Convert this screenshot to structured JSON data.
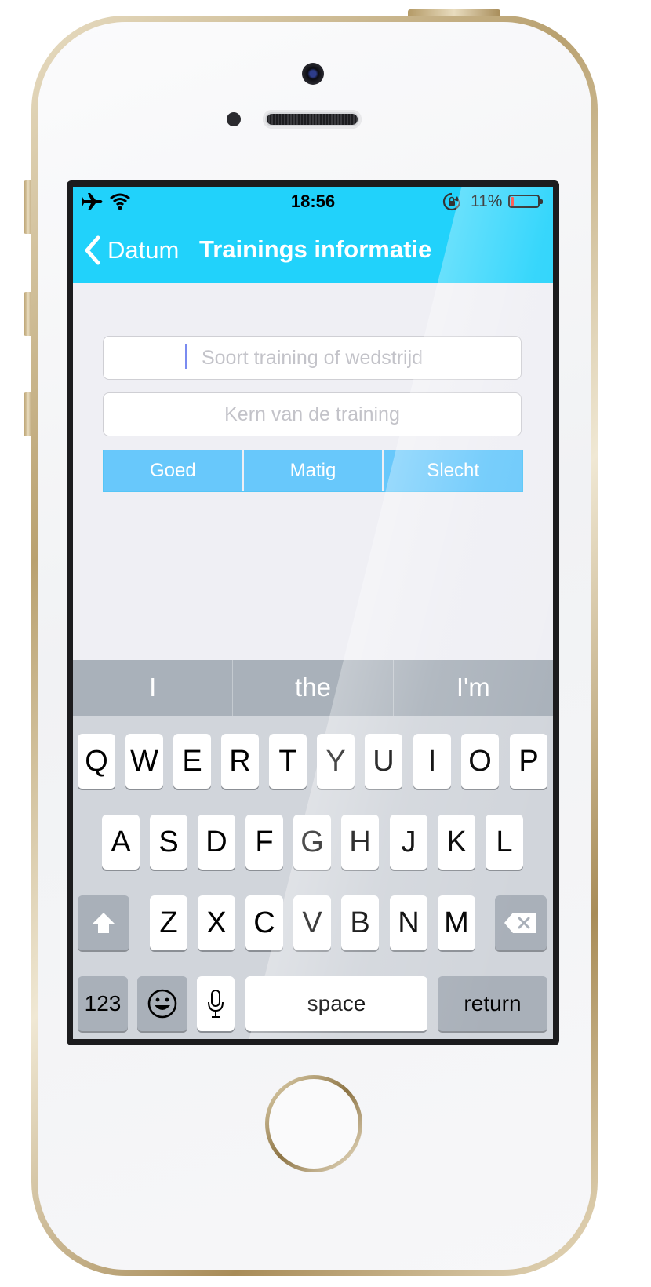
{
  "status_bar": {
    "time": "18:56",
    "battery_percent": "11%",
    "battery_level": 0.11,
    "icons": [
      "airplane-icon",
      "wifi-icon",
      "rotation-lock-icon",
      "battery-icon"
    ]
  },
  "nav": {
    "back_label": "Datum",
    "title": "Trainings informatie",
    "bar_color": "#21d2fb"
  },
  "form": {
    "training_type_placeholder": "Soort training of wedstrijd",
    "training_core_placeholder": "Kern van de training",
    "rating_options": [
      "Goed",
      "Matig",
      "Slecht"
    ],
    "segment_color": "#68c8fb"
  },
  "keyboard": {
    "suggestions": [
      "I",
      "the",
      "I'm"
    ],
    "row1": [
      "Q",
      "W",
      "E",
      "R",
      "T",
      "Y",
      "U",
      "I",
      "O",
      "P"
    ],
    "row2": [
      "A",
      "S",
      "D",
      "F",
      "G",
      "H",
      "J",
      "K",
      "L"
    ],
    "row3": [
      "Z",
      "X",
      "C",
      "V",
      "B",
      "N",
      "M"
    ],
    "numbers_label": "123",
    "space_label": "space",
    "return_label": "return"
  }
}
